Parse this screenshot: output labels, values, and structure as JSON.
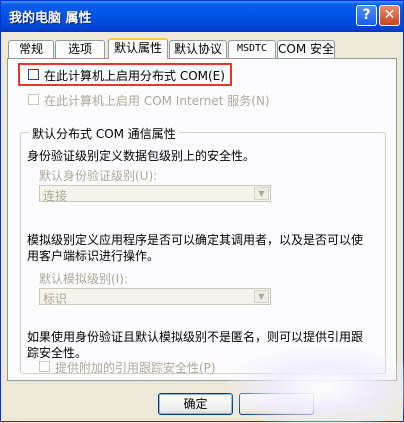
{
  "window": {
    "title": "我的电脑 属性",
    "help_glyph": "?",
    "close_glyph": "✕"
  },
  "tabs": [
    {
      "label": "常规"
    },
    {
      "label": "选项"
    },
    {
      "label": "默认属性"
    },
    {
      "label": "默认协议"
    },
    {
      "label": "MSDTC"
    },
    {
      "label": "COM 安全"
    }
  ],
  "options": {
    "enable_dcom": {
      "label": "在此计算机上启用分布式 COM(E)",
      "checked": false
    },
    "enable_com_internet": {
      "label": "在此计算机上启用 COM Internet 服务(N)",
      "checked": false
    }
  },
  "group": {
    "legend": "默认分布式 COM 通信属性",
    "auth_desc": "身份验证级别定义数据包级别上的安全性。",
    "auth_label": "默认身份验证级别(U):",
    "auth_value": "连接",
    "imp_desc_1": "模拟级别定义应用程序是否可以确定其调用者，以及是否可以使",
    "imp_desc_2": "用客户端标识进行操作。",
    "imp_label": "默认模拟级别(I):",
    "imp_value": "标识",
    "ref_desc_1": "如果使用身份验证且默认模拟级别不是匿名，则可以提供引用跟",
    "ref_desc_2": "踪安全性。",
    "ref_check_label": "提供附加的引用跟踪安全性(P)"
  },
  "buttons": {
    "ok": "确定"
  },
  "colors": {
    "title_bar": "#0055e5",
    "highlight": "#e8362a",
    "tab_accent": "#ffc83c"
  },
  "icons": {
    "dropdown": "▼"
  }
}
